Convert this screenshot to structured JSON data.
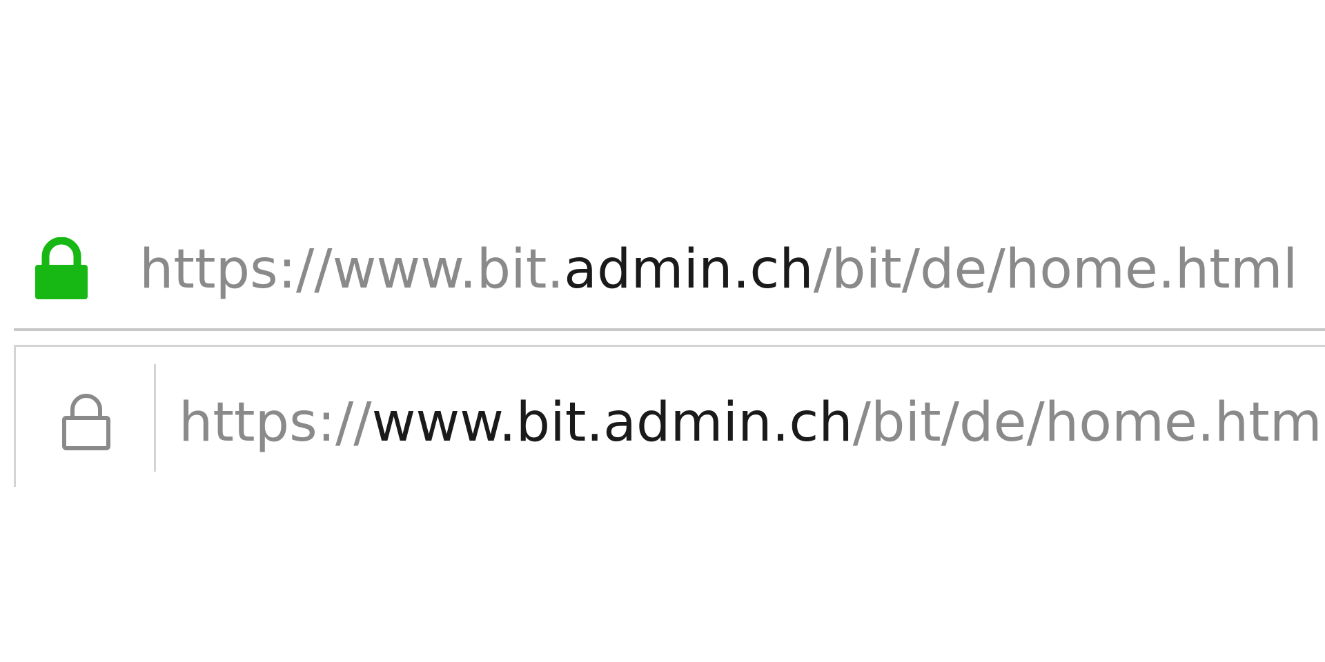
{
  "address_bar_1": {
    "lock_icon": "padlock-closed-filled",
    "lock_color": "#17b814",
    "url": {
      "prefix": "https://www.bit.",
      "domain": "admin.ch",
      "path": "/bit/de/home.html"
    }
  },
  "address_bar_2": {
    "lock_icon": "padlock-closed-outline",
    "lock_color": "#8a8a8a",
    "url": {
      "prefix": "https://",
      "domain": "www.bit.admin.ch",
      "path": "/bit/de/home.html"
    }
  },
  "colors": {
    "text_dim": "#8a8a8a",
    "text_dark": "#1a1a1a",
    "border": "#d4d4d4"
  }
}
